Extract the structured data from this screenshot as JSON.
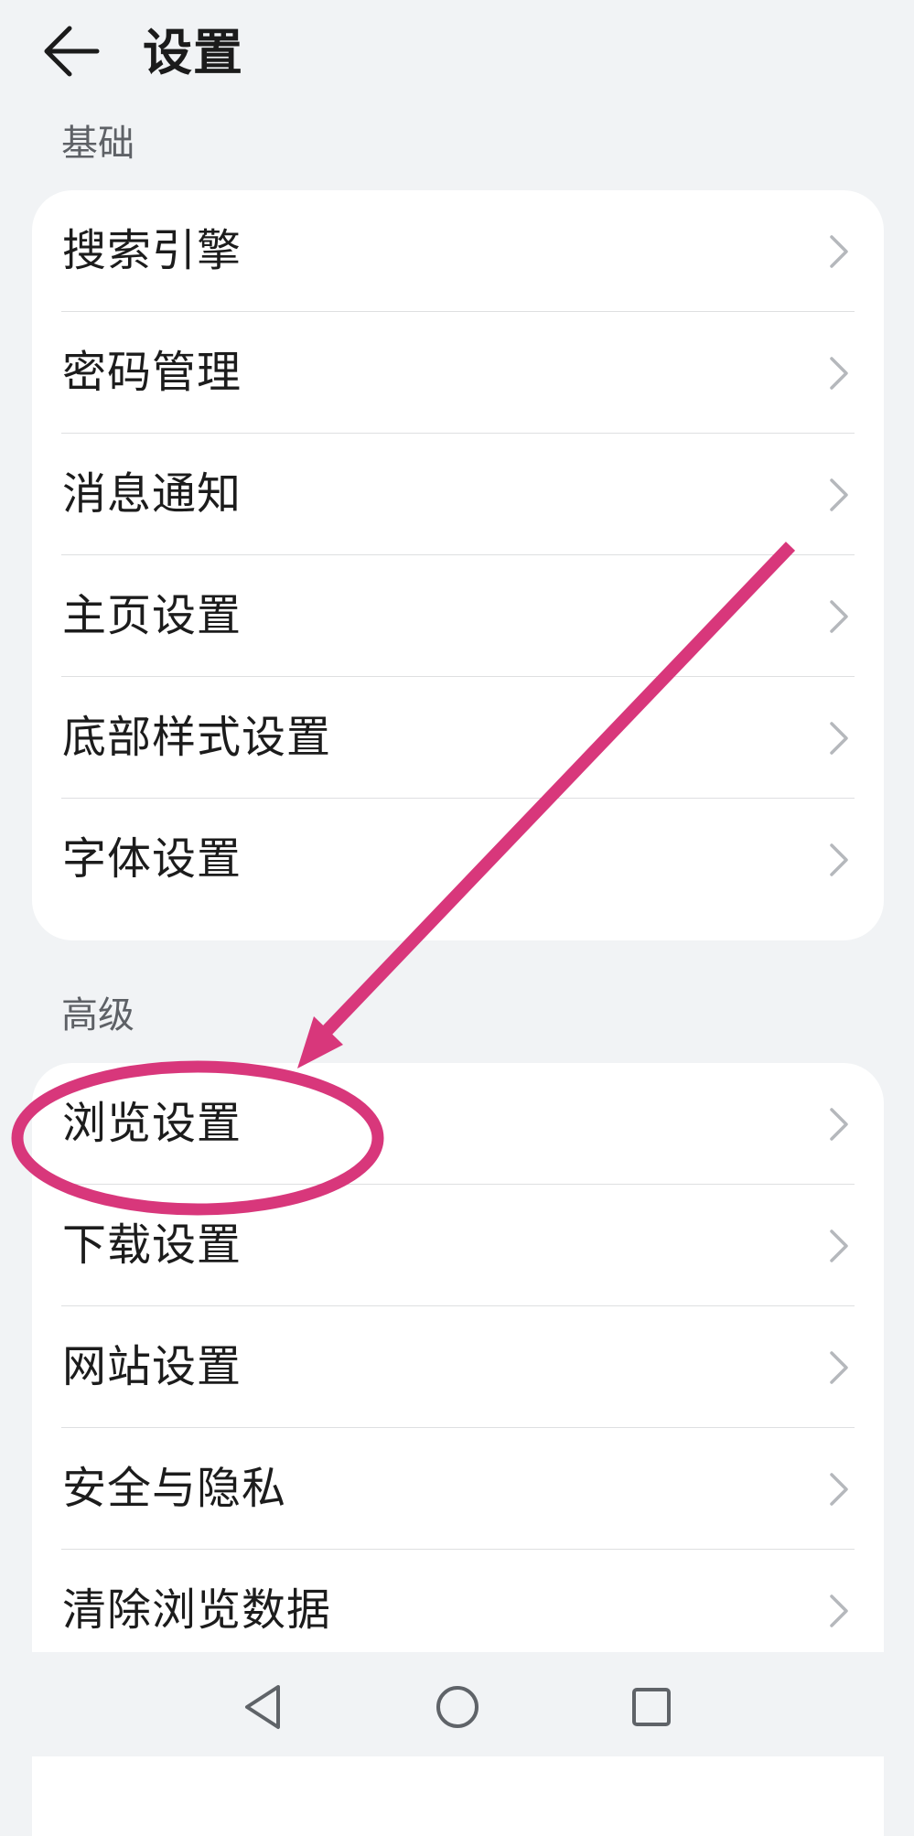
{
  "header": {
    "title": "设置",
    "back_icon": "arrow-left-icon"
  },
  "sections": [
    {
      "label": "基础",
      "items": [
        {
          "label": "搜索引擎"
        },
        {
          "label": "密码管理"
        },
        {
          "label": "消息通知"
        },
        {
          "label": "主页设置"
        },
        {
          "label": "底部样式设置"
        },
        {
          "label": "字体设置"
        }
      ]
    },
    {
      "label": "高级",
      "items": [
        {
          "label": "浏览设置"
        },
        {
          "label": "下载设置"
        },
        {
          "label": "网站设置"
        },
        {
          "label": "安全与隐私"
        },
        {
          "label": "清除浏览数据"
        }
      ]
    }
  ],
  "navbar": {
    "back_icon": "triangle-back-icon",
    "home_icon": "circle-home-icon",
    "recent_icon": "square-recent-icon"
  },
  "colors": {
    "background": "#f1f3f5",
    "card": "#ffffff",
    "annotation": "#d8377b",
    "chevron": "#b5b8bc",
    "section_label": "#5e6166"
  }
}
